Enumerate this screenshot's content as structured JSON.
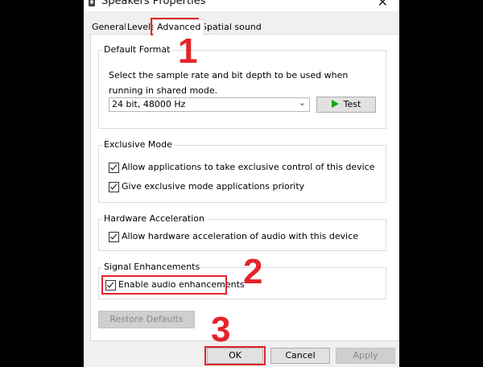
{
  "window": {
    "title": "Speakers Properties"
  },
  "tabs": [
    {
      "label": "General"
    },
    {
      "label": "Levels"
    },
    {
      "label": "Advanced"
    },
    {
      "label": "Spatial sound"
    }
  ],
  "default_format": {
    "legend": "Default Format",
    "description": "Select the sample rate and bit depth to be used when running in shared mode.",
    "selected": "24 bit, 48000 Hz",
    "test_label": "Test"
  },
  "exclusive_mode": {
    "legend": "Exclusive Mode",
    "options": [
      {
        "label": "Allow applications to take exclusive control of this device",
        "checked": true
      },
      {
        "label": "Give exclusive mode applications priority",
        "checked": true
      }
    ]
  },
  "hardware_acceleration": {
    "legend": "Hardware Acceleration",
    "option": {
      "label": "Allow hardware acceleration of audio with this device",
      "checked": true
    }
  },
  "signal_enhancements": {
    "legend": "Signal Enhancements",
    "option": {
      "label": "Enable audio enhancements",
      "checked": true
    }
  },
  "buttons": {
    "restore_defaults": "Restore Defaults",
    "ok": "OK",
    "cancel": "Cancel",
    "apply": "Apply"
  },
  "annotations": {
    "step1": "1",
    "step2": "2",
    "step3": "3"
  },
  "colors": {
    "highlight": "#e3242b",
    "play": "#14a814"
  }
}
